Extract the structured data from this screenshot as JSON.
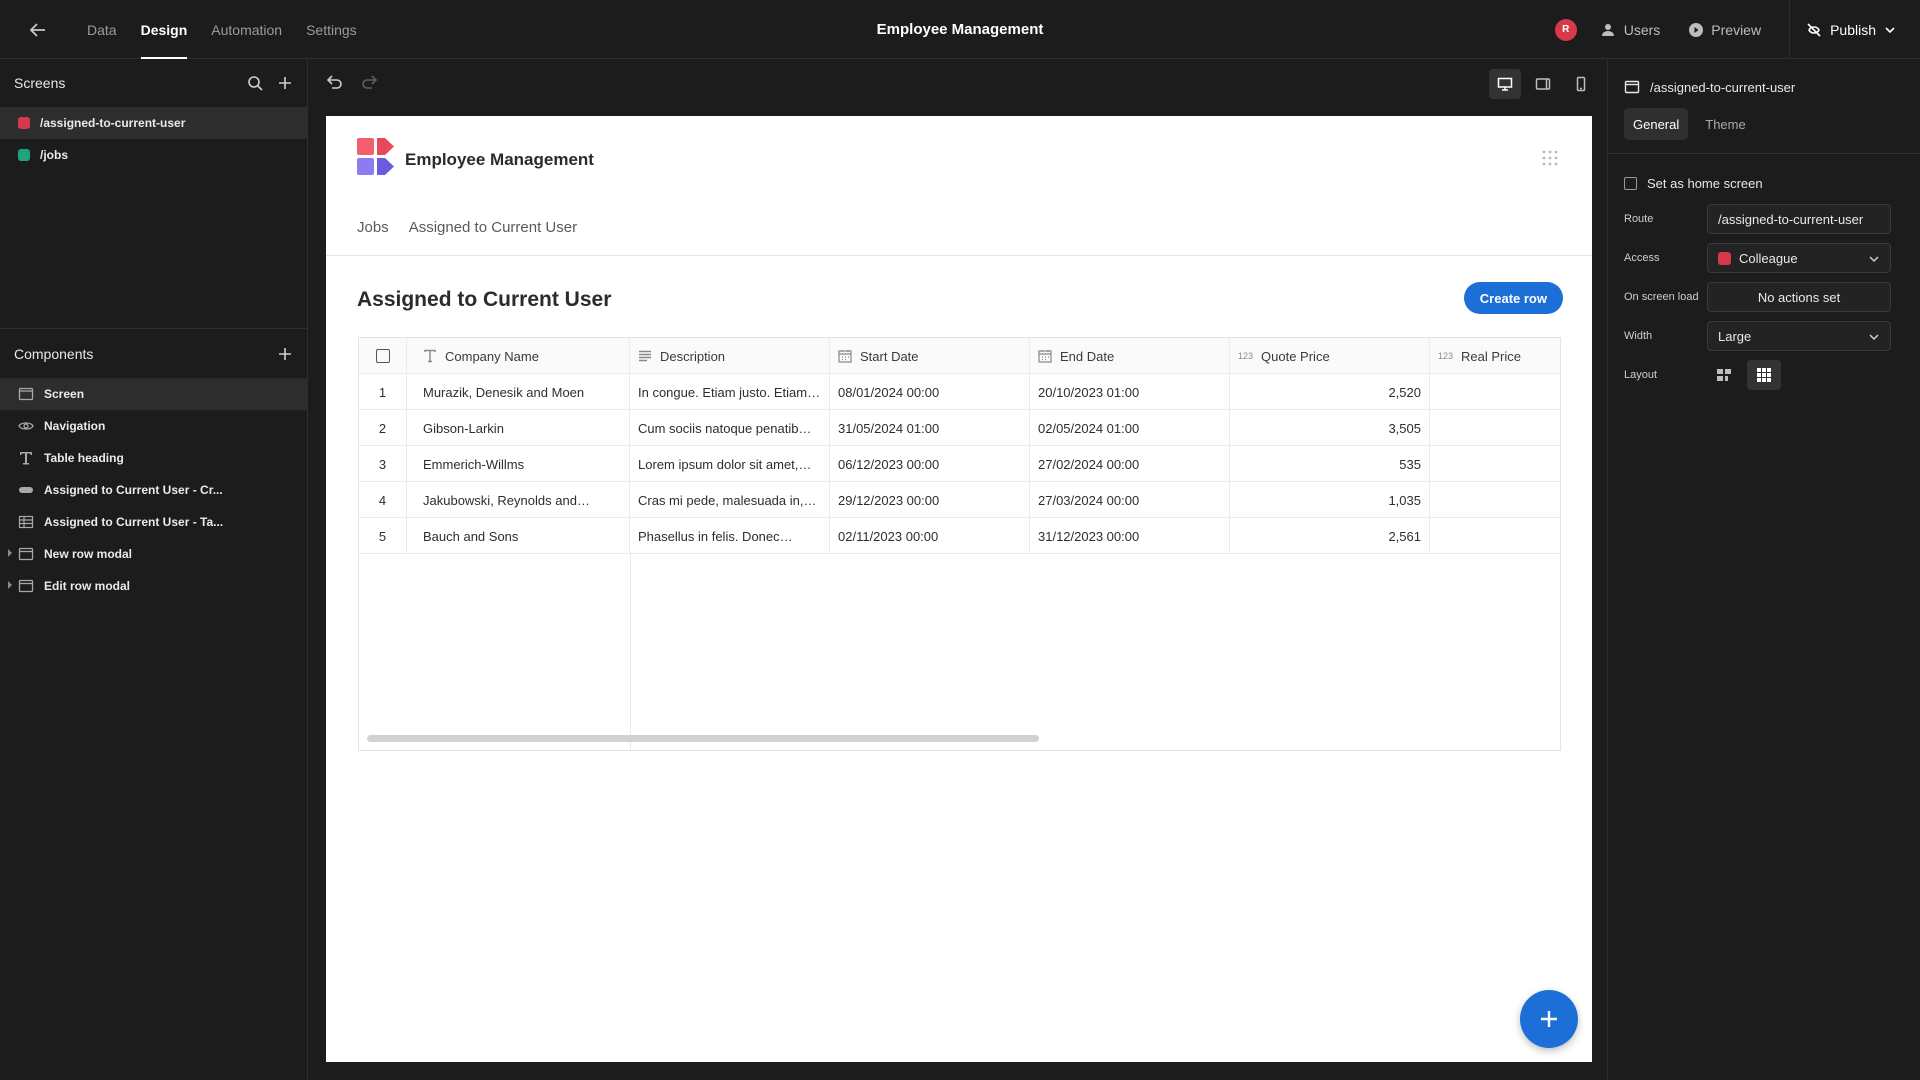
{
  "topbar": {
    "tabs": [
      {
        "label": "Data",
        "active": false
      },
      {
        "label": "Design",
        "active": true
      },
      {
        "label": "Automation",
        "active": false
      },
      {
        "label": "Settings",
        "active": false
      }
    ],
    "title": "Employee Management",
    "avatar_initial": "R",
    "users_label": "Users",
    "preview_label": "Preview",
    "publish_label": "Publish"
  },
  "sidebar": {
    "screens_title": "Screens",
    "screens": [
      {
        "route": "/assigned-to-current-user",
        "color": "#d6394a",
        "selected": true
      },
      {
        "route": "/jobs",
        "color": "#1fa37a",
        "selected": false
      }
    ],
    "components_title": "Components",
    "components": [
      {
        "label": "Screen",
        "icon": "screen-icon",
        "selected": true
      },
      {
        "label": "Navigation",
        "icon": "eye-icon",
        "selected": false
      },
      {
        "label": "Table heading",
        "icon": "text-icon",
        "selected": false
      },
      {
        "label": "Assigned to Current User - Cr...",
        "icon": "button-icon",
        "selected": false
      },
      {
        "label": "Assigned to Current User - Ta...",
        "icon": "table-icon",
        "selected": false
      },
      {
        "label": "New row modal",
        "icon": "modal-icon",
        "selected": false,
        "expandable": true
      },
      {
        "label": "Edit row modal",
        "icon": "modal-icon",
        "selected": false,
        "expandable": true
      }
    ]
  },
  "canvas": {
    "app_name": "Employee Management",
    "nav": [
      "Jobs",
      "Assigned to Current User"
    ],
    "page_title": "Assigned to Current User",
    "create_button": "Create row",
    "table": {
      "columns": [
        {
          "label": "Company Name",
          "icon": "text-type-icon"
        },
        {
          "label": "Description",
          "icon": "longform-icon"
        },
        {
          "label": "Start Date",
          "icon": "calendar-icon"
        },
        {
          "label": "End Date",
          "icon": "calendar-icon"
        },
        {
          "label": "Quote Price",
          "icon": "number-icon",
          "icon_text": "123"
        },
        {
          "label": "Real Price",
          "icon": "number-icon",
          "icon_text": "123"
        }
      ],
      "rows": [
        {
          "n": "1",
          "company": "Murazik, Denesik and Moen",
          "description": "In congue. Etiam justo. Etiam…",
          "start": "08/01/2024 00:00",
          "end": "20/10/2023 01:00",
          "quote": "2,520",
          "real": ""
        },
        {
          "n": "2",
          "company": "Gibson-Larkin",
          "description": "Cum sociis natoque penatib…",
          "start": "31/05/2024 01:00",
          "end": "02/05/2024 01:00",
          "quote": "3,505",
          "real": ""
        },
        {
          "n": "3",
          "company": "Emmerich-Willms",
          "description": "Lorem ipsum dolor sit amet,…",
          "start": "06/12/2023 00:00",
          "end": "27/02/2024 00:00",
          "quote": "535",
          "real": ""
        },
        {
          "n": "4",
          "company": "Jakubowski, Reynolds and…",
          "description": "Cras mi pede, malesuada in,…",
          "start": "29/12/2023 00:00",
          "end": "27/03/2024 00:00",
          "quote": "1,035",
          "real": ""
        },
        {
          "n": "5",
          "company": "Bauch and Sons",
          "description": "Phasellus in felis. Donec…",
          "start": "02/11/2023 00:00",
          "end": "31/12/2023 00:00",
          "quote": "2,561",
          "real": ""
        }
      ]
    }
  },
  "rpanel": {
    "screen_route": "/assigned-to-current-user",
    "tabs": [
      {
        "label": "General",
        "active": true
      },
      {
        "label": "Theme",
        "active": false
      }
    ],
    "home_screen_label": "Set as home screen",
    "route_label": "Route",
    "route_value": "/assigned-to-current-user",
    "access_label": "Access",
    "access_value": "Colleague",
    "access_color": "#d6394a",
    "on_load_label": "On screen load",
    "on_load_value": "No actions set",
    "width_label": "Width",
    "width_value": "Large",
    "layout_label": "Layout"
  },
  "colors": {
    "accent": "#1d6fd8",
    "role_red": "#d6394a",
    "screen_green": "#1fa37a"
  }
}
